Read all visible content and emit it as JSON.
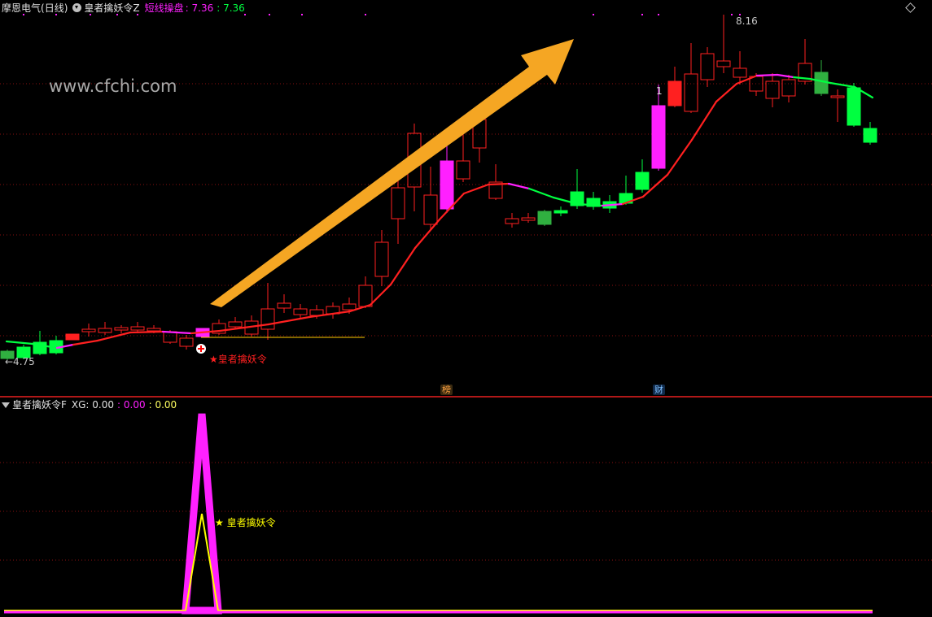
{
  "main_header": {
    "stock_name": "摩恩电气",
    "period": "(日线)",
    "indicator_name": "皇者擒妖令Z",
    "param_label": "短线操盘",
    "param_value_1": ": 7.36",
    "param_value_2": ": 7.36"
  },
  "sub_header": {
    "indicator_name": "皇者擒妖令F",
    "xg_label": "XG: 0.00",
    "value_2": ": 0.00",
    "value_3": ": 0.00"
  },
  "watermark": "www.cfchi.com",
  "low_label": "←4.75",
  "high_label": "8.16",
  "signal_text_main": "★皇者擒妖令",
  "signal_text_sub": "★ 皇者擒妖令",
  "marker_1": "1",
  "badge_bang": "榜",
  "badge_cai": "财",
  "colors": {
    "up": "#ff2020",
    "down": "#00ff40",
    "magenta": "#ff20ff",
    "grid": "#8a1010",
    "arrow": "#f5a623",
    "yellow": "#ffff00"
  },
  "icons": [
    "chevron-down-icon",
    "settings-circle-icon",
    "diamond-icon",
    "arrow-icon",
    "plus-circle-icon"
  ]
}
